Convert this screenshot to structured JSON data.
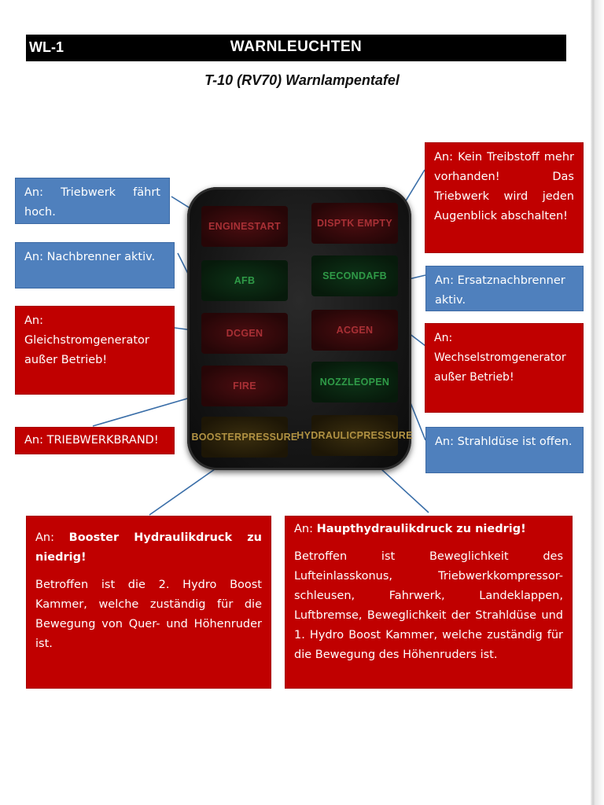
{
  "header": {
    "code": "WL-1",
    "title": "WARNLEUCHTEN"
  },
  "subtitle": "T-10 (RV70) Warnlampentafel",
  "panel": {
    "lamps": [
      {
        "label": "ENGINE START",
        "color": "red"
      },
      {
        "label": "DISP TK EMPTY",
        "color": "red"
      },
      {
        "label": "AFB",
        "color": "green"
      },
      {
        "label": "SECOND AFB",
        "color": "green"
      },
      {
        "label": "DC GEN",
        "color": "red"
      },
      {
        "label": "AC GEN",
        "color": "red"
      },
      {
        "label": "FIRE",
        "color": "red"
      },
      {
        "label": "NOZZLE OPEN",
        "color": "green"
      },
      {
        "label": "BOOSTER PRESSURE",
        "color": "yellow"
      },
      {
        "label": "HYDRAULIC PRESSURE",
        "color": "yellow"
      }
    ]
  },
  "boxes": {
    "engine_start": "An: Triebwerk fährt hoch.",
    "afb": "An:  Nachbrenner aktiv.",
    "dc_gen": "An: Gleichstromgenerator außer Betrieb!",
    "fire": "An: TRIEBWERKBRAND!",
    "disp_tk": "An: Kein Treibstoff mehr vorhanden! Das Triebwerk wird jeden Augenblick abschalten!",
    "second_afb": "An: Ersatznachbrenner aktiv.",
    "ac_gen": "An: Wechselstromgenerator außer Betrieb!",
    "nozzle": "An: Strahldüse ist offen.",
    "booster": {
      "prefix": "An:",
      "bold": "Booster Hydraulikdruck zu niedrig!",
      "body": "Betroffen ist die 2. Hydro Boost Kammer, welche zuständig für die Bewegung von Quer- und Höhenruder ist."
    },
    "hydraulic": {
      "prefix": "An:",
      "bold": "Haupthydraulikdruck zu niedrig!",
      "body": "Betroffen ist Beweglichkeit des Lufteinlasskonus, Triebwerkkompressor-schleusen, Fahrwerk, Landeklappen, Luftbremse, Beweglichkeit der Strahldüse und 1. Hydro Boost Kammer, welche zuständig für die Bewegung des Höhenruders ist."
    }
  },
  "colors": {
    "blue": "#4f80bd",
    "red": "#c00000",
    "header": "#000000",
    "line": "#3a6ea8"
  }
}
